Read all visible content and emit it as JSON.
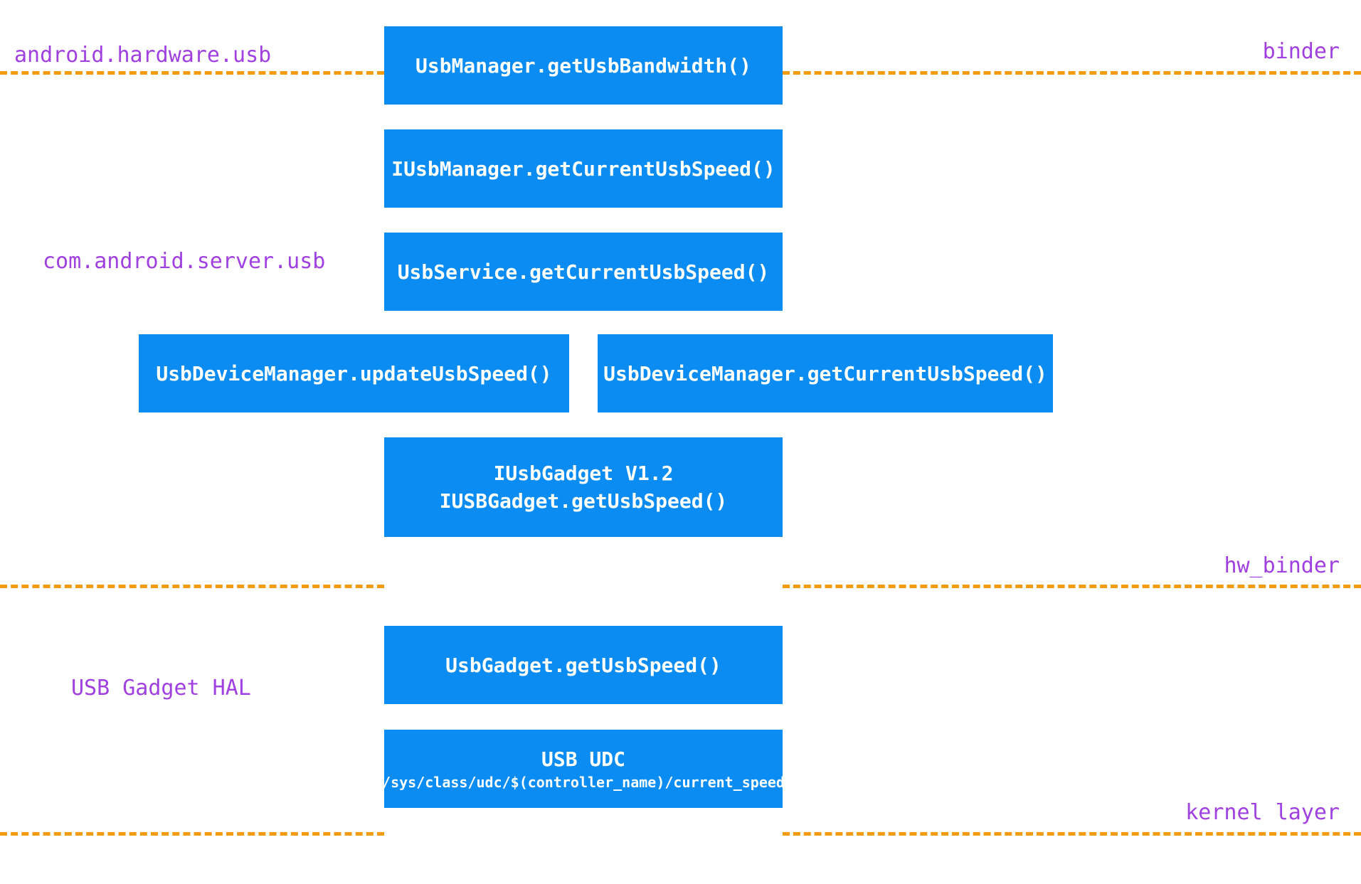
{
  "labels": {
    "android_hardware_usb": "android.hardware.usb",
    "binder": "binder",
    "com_android_server_usb": "com.android.server.usb",
    "hw_binder": "hw_binder",
    "usb_gadget_hal": "USB Gadget HAL",
    "kernel_layer": "kernel layer"
  },
  "boxes": {
    "usbmanager_getusbbandwidth": "UsbManager.getUsbBandwidth()",
    "iusbmanager_getcurrentusbspeed": "IUsbManager.getCurrentUsbSpeed()",
    "usbservice_getcurrentusbspeed": "UsbService.getCurrentUsbSpeed()",
    "usbdevicemanager_updateusbspeed": "UsbDeviceManager.updateUsbSpeed()",
    "usbdevicemanager_getcurrentusbspeed": "UsbDeviceManager.getCurrentUsbSpeed()",
    "iusbgadget_title": "IUsbGadget V1.2",
    "iusbgadget_method": "IUSBGadget.getUsbSpeed()",
    "usbgadget_getusbspeed": "UsbGadget.getUsbSpeed()",
    "usb_udc_title": "USB UDC",
    "usb_udc_path": "/sys/class/udc/$(controller_name)/current_speed"
  }
}
